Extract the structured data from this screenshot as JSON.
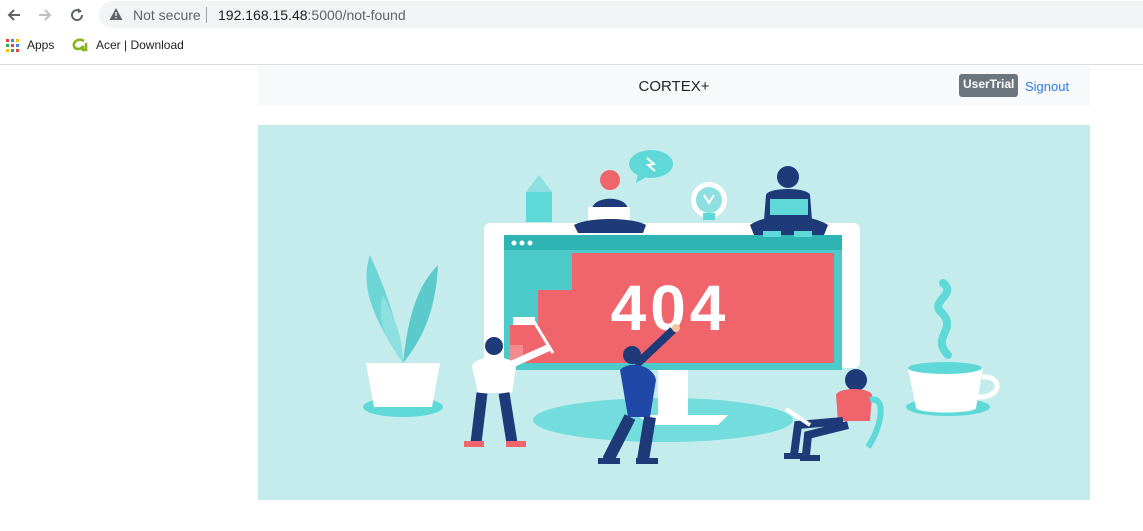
{
  "browser": {
    "security_label": "Not secure",
    "url_host": "192.168.15.48",
    "url_rest": ":5000/not-found"
  },
  "bookmarks": [
    {
      "label": "Apps"
    },
    {
      "label": "Acer | Download"
    }
  ],
  "navbar": {
    "brand": "CORTEX+",
    "user_badge": "UserTrial",
    "signout": "Signout"
  },
  "illustration": {
    "code": "404",
    "colors": {
      "background": "#c4ecec",
      "screen": "#f0646c",
      "accent": "#5fd8d8",
      "navy": "#1e3a78"
    }
  }
}
